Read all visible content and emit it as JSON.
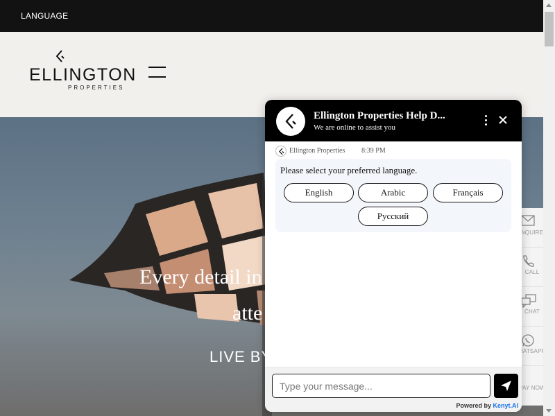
{
  "topbar": {
    "language_label": "LANGUAGE"
  },
  "header": {
    "logo_word": "ELLINGTON",
    "logo_sub": "PROPERTIES"
  },
  "hero": {
    "line1": "Every detail in l",
    "line2": "atte",
    "cta": "LIVE BY"
  },
  "sidebar": {
    "items": [
      {
        "label": "NQUIRE",
        "icon": "envelope-icon"
      },
      {
        "label": "CALL",
        "icon": "phone-icon"
      },
      {
        "label": "CHAT",
        "icon": "chat-icon"
      },
      {
        "label": "HATSAPP",
        "icon": "whatsapp-icon"
      },
      {
        "label": "PAY NOW",
        "icon": "pay-icon"
      }
    ]
  },
  "chat": {
    "title": "Ellington Properties Help D...",
    "subtitle": "We are online to assist you",
    "sender": "Ellington Properties",
    "time": "8:39 PM",
    "prompt": "Please select your preferred language.",
    "options": [
      "English",
      "Arabic",
      "Français",
      "Русский"
    ],
    "input_placeholder": "Type your message...",
    "powered_by_prefix": "Powered by",
    "powered_by_brand": "Kenyt.AI"
  },
  "colors": {
    "header_bg": "#000000",
    "topbar_bg": "#121212",
    "page_bg": "#f2f0ed",
    "bubble_bg": "#f3f6fa",
    "brand_link": "#1a73e8"
  }
}
